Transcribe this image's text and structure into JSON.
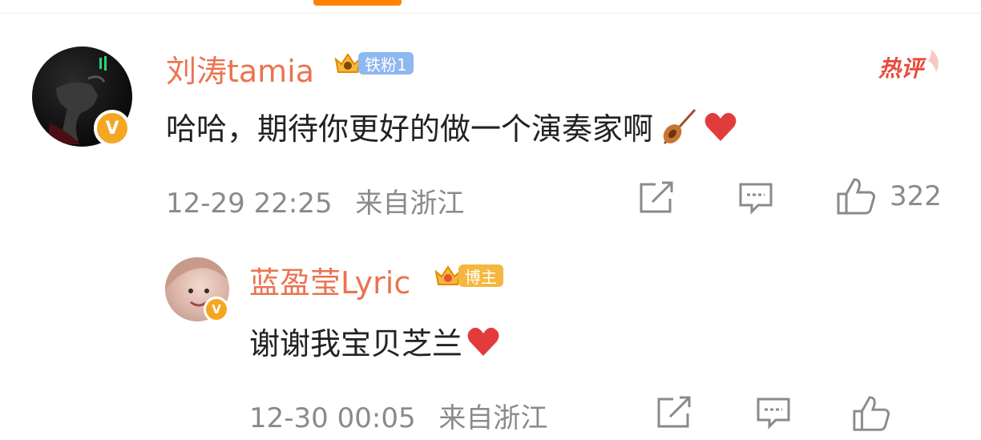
{
  "comment": {
    "username": "刘涛tamia",
    "fan_badge": "铁粉1",
    "hot_label": "热评",
    "text": "哈哈，期待你更好的做一个演奏家啊",
    "time": "12-29 22:25",
    "location": "来自浙江",
    "likes": "322"
  },
  "reply": {
    "username": "蓝盈莹Lyric",
    "role_badge": "博主",
    "text": "谢谢我宝贝芝兰",
    "time": "12-30 00:05",
    "location": "来自浙江"
  },
  "colors": {
    "accent": "#ff8200",
    "username": "#eb7350",
    "hot": "#e94c3d",
    "meta_text": "#8a8a8a"
  },
  "icons": [
    "verified-badge-icon",
    "crown-icon",
    "violin-emoji-icon",
    "heart-emoji-icon",
    "share-icon",
    "comment-icon",
    "like-icon"
  ]
}
